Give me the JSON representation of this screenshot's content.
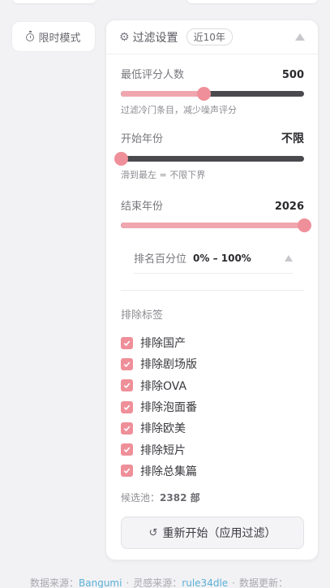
{
  "timer": {
    "label": "限时模式",
    "icon": "timer-icon"
  },
  "filter": {
    "title": "过滤设置",
    "badge": "近10年",
    "min_ratings": {
      "label": "最低评分人数",
      "value": "500",
      "fill": 0.45,
      "hint": "过滤冷门条目，减少噪声评分"
    },
    "start_year": {
      "label": "开始年份",
      "value": "不限",
      "fill": 0.0,
      "hint": "滑到最左 = 不限下界"
    },
    "end_year": {
      "label": "结束年份",
      "value": "2026",
      "fill": 1.0
    },
    "rank_percentile": {
      "label": "排名百分位",
      "value": "0% – 100%"
    },
    "exclude": {
      "title": "排除标签",
      "items": [
        {
          "label": "排除国产",
          "checked": true
        },
        {
          "label": "排除剧场版",
          "checked": true
        },
        {
          "label": "排除OVA",
          "checked": true
        },
        {
          "label": "排除泡面番",
          "checked": true
        },
        {
          "label": "排除欧美",
          "checked": true
        },
        {
          "label": "排除短片",
          "checked": true
        },
        {
          "label": "排除总集篇",
          "checked": true
        }
      ]
    },
    "pool": {
      "prefix": "候选池：",
      "count": "2382 部"
    },
    "restart_label": "重新开始（应用过滤）"
  },
  "footer": {
    "source_label": "数据来源：",
    "source_link": "Bangumi",
    "inspire_label": "灵感来源：",
    "inspire_link": "rule34dle",
    "update_label": "数据更新："
  },
  "colors": {
    "accent": "#ef8f99",
    "accent_light": "#f0a6ae",
    "track_dark": "#4a4a4e"
  }
}
